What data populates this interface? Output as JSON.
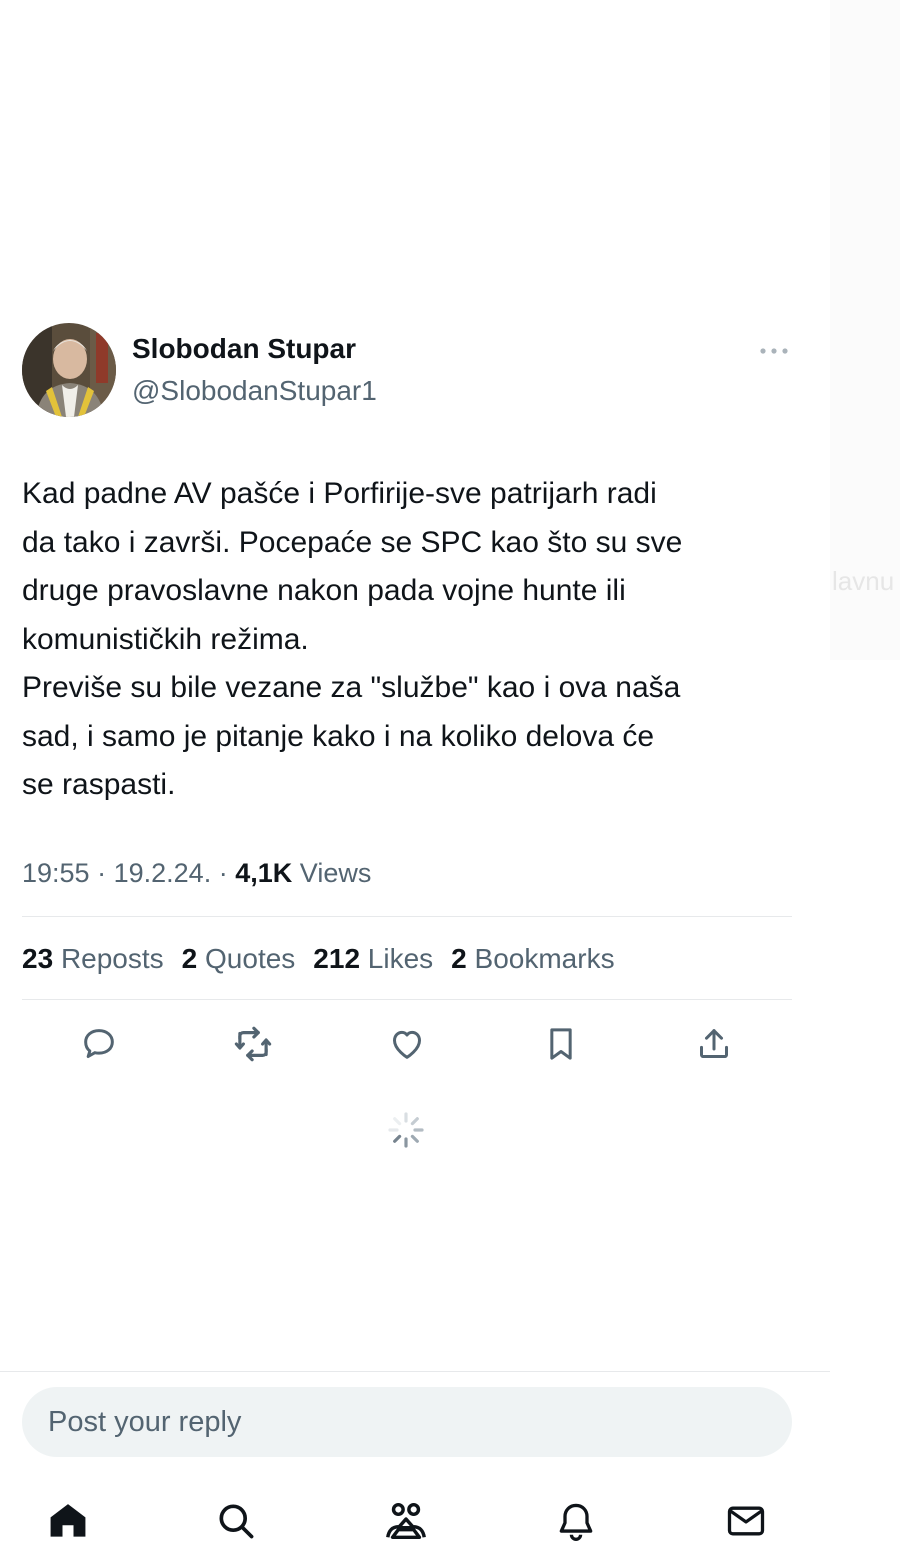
{
  "tweet": {
    "author_name": "Slobodan Stupar",
    "author_handle": "@SlobodanStupar1",
    "text": "Kad padne AV pašće i Porfirije-sve patrijarh radi\nda tako i završi. Pocepaće se SPC kao što su sve\ndruge pravoslavne nakon pada vojne hunte ili\nkomunističkih režima.\nPreviše su bile vezane za \"službe\" kao i ova naša\nsad, i samo je pitanje kako i na koliko delova će\nse raspasti.",
    "time": "19:55",
    "date": "19.2.24.",
    "views_count": "4,1K",
    "views_label": "Views",
    "separator": "·"
  },
  "stats": {
    "reposts_count": "23",
    "reposts_label": "Reposts",
    "quotes_count": "2",
    "quotes_label": "Quotes",
    "likes_count": "212",
    "likes_label": "Likes",
    "bookmarks_count": "2",
    "bookmarks_label": "Bookmarks"
  },
  "reply": {
    "placeholder": "Post your reply"
  },
  "background_fragment": "lavnu",
  "icons": {
    "more": "more-horizontal-icon",
    "reply": "reply-icon",
    "repost": "repost-icon",
    "like": "heart-icon",
    "bookmark": "bookmark-icon",
    "share": "share-icon",
    "loading": "loading-spinner-icon",
    "nav": [
      "home-icon",
      "search-icon",
      "communities-icon",
      "notifications-icon",
      "messages-icon"
    ]
  },
  "colors": {
    "text_primary": "#0f1419",
    "text_secondary": "#536471",
    "divider": "#e7e9eb",
    "reply_bg": "#eff3f4"
  }
}
